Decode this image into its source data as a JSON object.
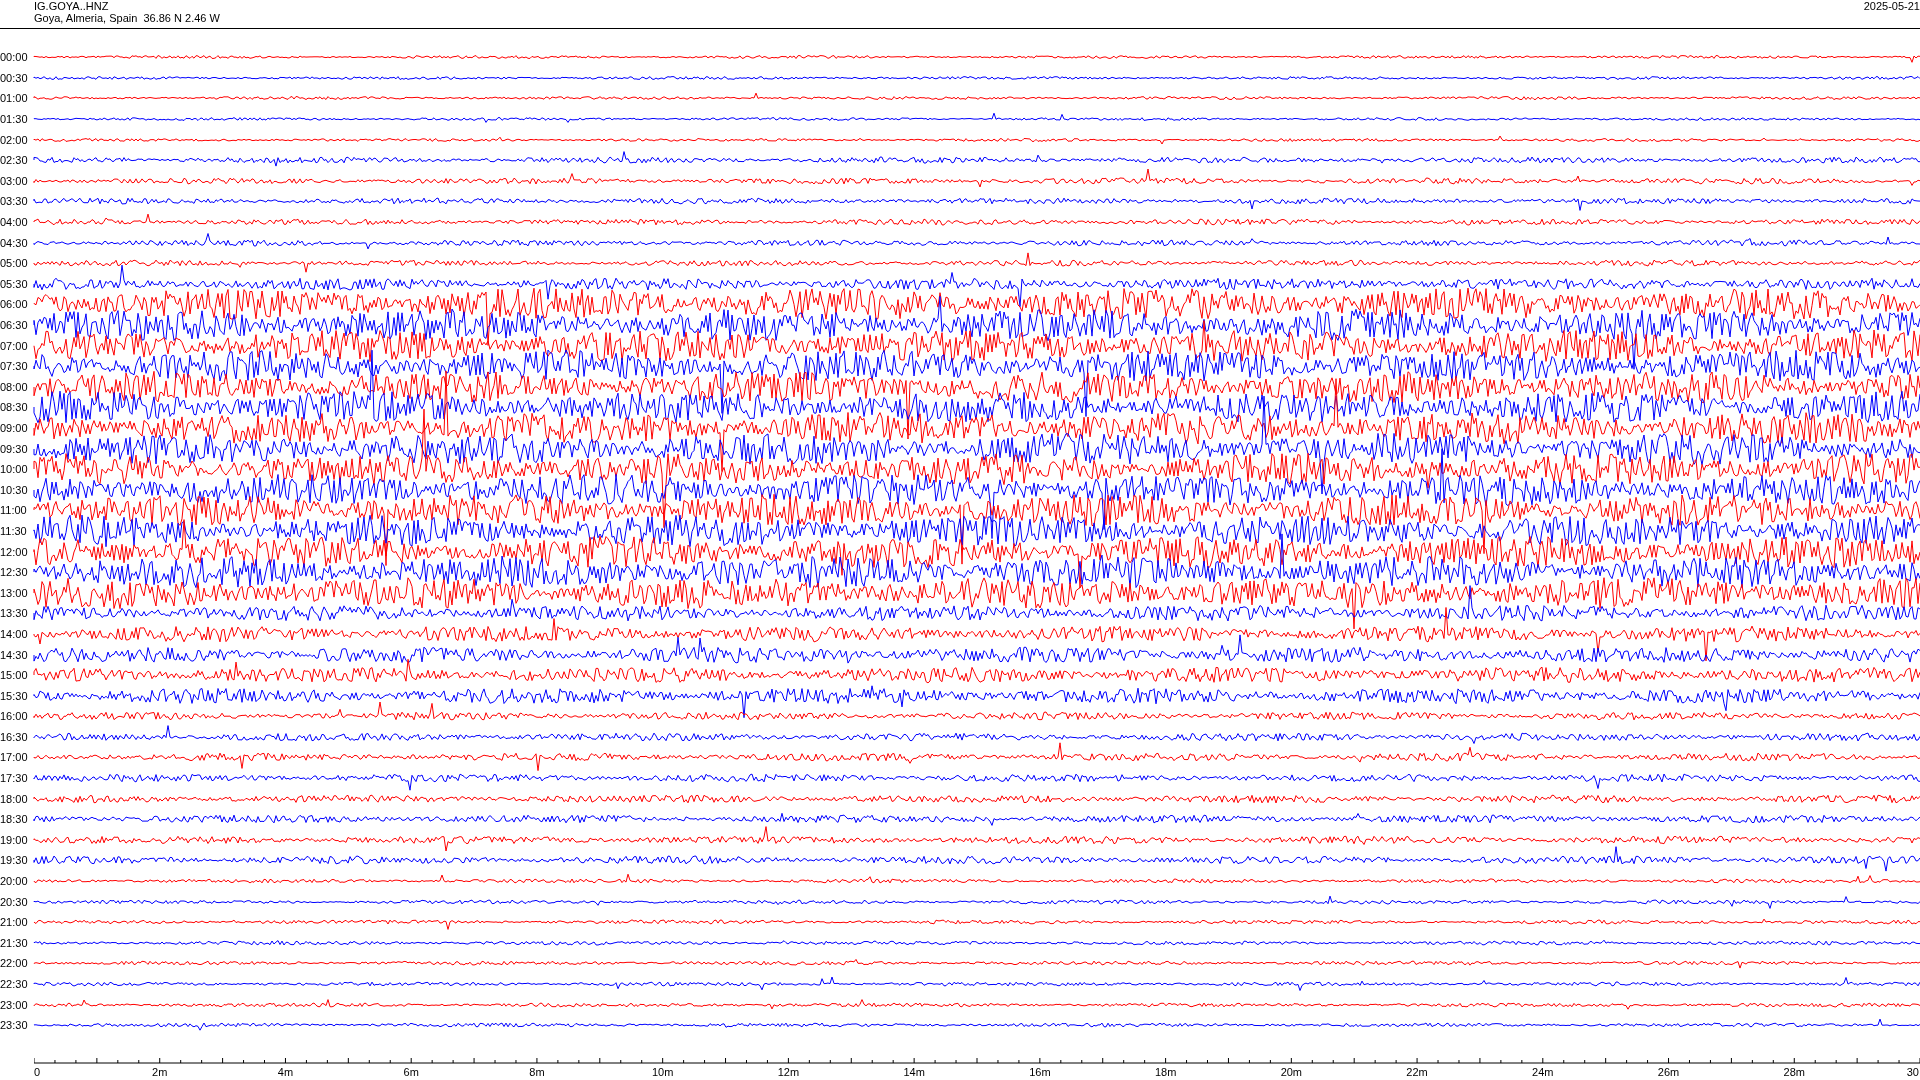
{
  "station": {
    "code": "IG.GOYA..HNZ",
    "location": "Goya, Almeria, Spain  36.86 N 2.46 W",
    "date": "2025-05-21"
  },
  "rows": [
    {
      "time": "00:00",
      "color": "#ff0000"
    },
    {
      "time": "00:30",
      "color": "#0000ff"
    },
    {
      "time": "01:00",
      "color": "#ff0000"
    },
    {
      "time": "01:30",
      "color": "#0000ff"
    },
    {
      "time": "02:00",
      "color": "#ff0000"
    },
    {
      "time": "02:30",
      "color": "#0000ff"
    },
    {
      "time": "03:00",
      "color": "#ff0000"
    },
    {
      "time": "03:30",
      "color": "#0000ff"
    },
    {
      "time": "04:00",
      "color": "#ff0000"
    },
    {
      "time": "04:30",
      "color": "#0000ff"
    },
    {
      "time": "05:00",
      "color": "#ff0000"
    },
    {
      "time": "05:30",
      "color": "#0000ff"
    },
    {
      "time": "06:00",
      "color": "#ff0000"
    },
    {
      "time": "06:30",
      "color": "#0000ff"
    },
    {
      "time": "07:00",
      "color": "#ff0000"
    },
    {
      "time": "07:30",
      "color": "#0000ff"
    },
    {
      "time": "08:00",
      "color": "#ff0000"
    },
    {
      "time": "08:30",
      "color": "#0000ff"
    },
    {
      "time": "09:00",
      "color": "#ff0000"
    },
    {
      "time": "09:30",
      "color": "#0000ff"
    },
    {
      "time": "10:00",
      "color": "#ff0000"
    },
    {
      "time": "10:30",
      "color": "#0000ff"
    },
    {
      "time": "11:00",
      "color": "#ff0000"
    },
    {
      "time": "11:30",
      "color": "#0000ff"
    },
    {
      "time": "12:00",
      "color": "#ff0000"
    },
    {
      "time": "12:30",
      "color": "#0000ff"
    },
    {
      "time": "13:00",
      "color": "#ff0000"
    },
    {
      "time": "13:30",
      "color": "#0000ff"
    },
    {
      "time": "14:00",
      "color": "#ff0000"
    },
    {
      "time": "14:30",
      "color": "#0000ff"
    },
    {
      "time": "15:00",
      "color": "#ff0000"
    },
    {
      "time": "15:30",
      "color": "#0000ff"
    },
    {
      "time": "16:00",
      "color": "#ff0000"
    },
    {
      "time": "16:30",
      "color": "#0000ff"
    },
    {
      "time": "17:00",
      "color": "#ff0000"
    },
    {
      "time": "17:30",
      "color": "#0000ff"
    },
    {
      "time": "18:00",
      "color": "#ff0000"
    },
    {
      "time": "18:30",
      "color": "#0000ff"
    },
    {
      "time": "19:00",
      "color": "#ff0000"
    },
    {
      "time": "19:30",
      "color": "#0000ff"
    },
    {
      "time": "20:00",
      "color": "#ff0000"
    },
    {
      "time": "20:30",
      "color": "#0000ff"
    },
    {
      "time": "21:00",
      "color": "#ff0000"
    },
    {
      "time": "21:30",
      "color": "#0000ff"
    },
    {
      "time": "22:00",
      "color": "#ff0000"
    },
    {
      "time": "22:30",
      "color": "#0000ff"
    },
    {
      "time": "23:00",
      "color": "#ff0000"
    },
    {
      "time": "23:30",
      "color": "#0000ff"
    }
  ],
  "axis": {
    "labels": [
      "0",
      "2m",
      "4m",
      "6m",
      "8m",
      "10m",
      "12m",
      "14m",
      "16m",
      "18m",
      "20m",
      "22m",
      "24m",
      "26m",
      "28m",
      "30"
    ]
  }
}
